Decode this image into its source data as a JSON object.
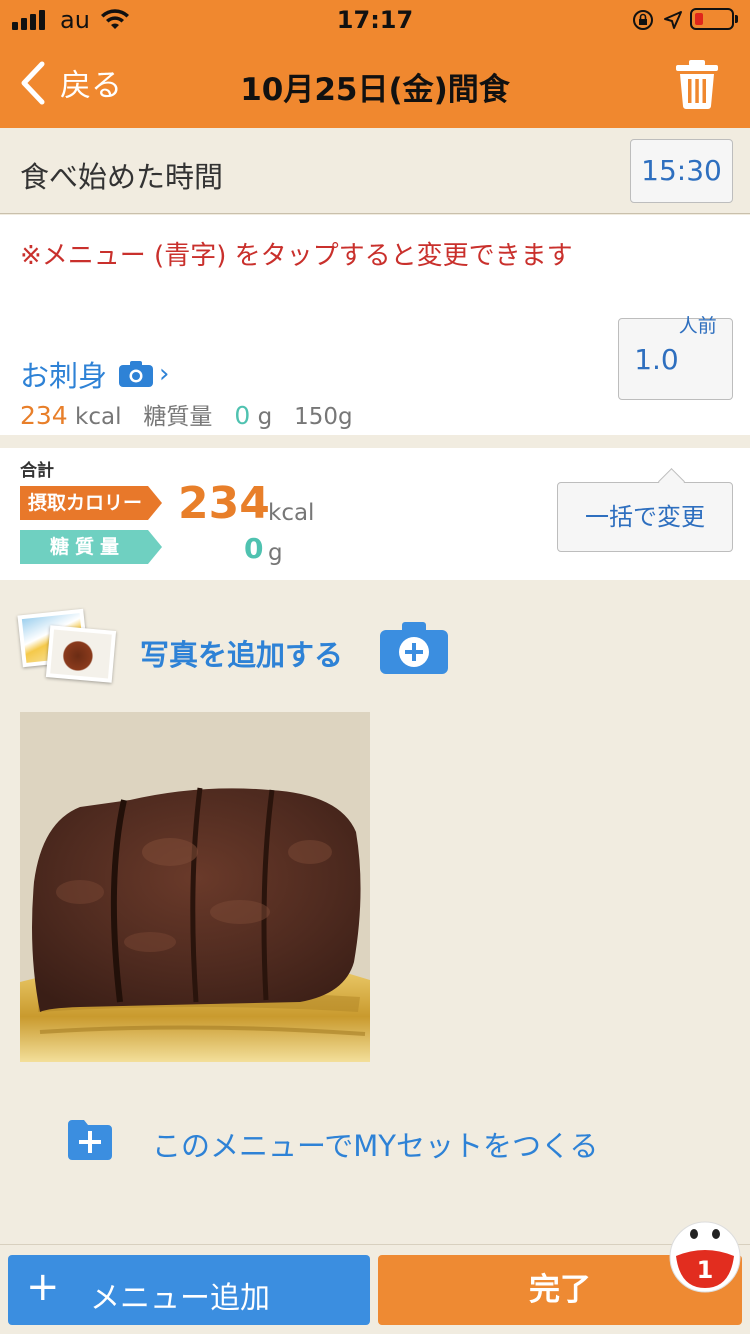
{
  "status": {
    "carrier": "au",
    "time": "17:17"
  },
  "nav": {
    "back_label": "戻る",
    "title": "10月25日(金)間食"
  },
  "start_time": {
    "label": "食べ始めた時間",
    "value": "15:30"
  },
  "menu": {
    "notice": "※メニュー (青字) をタップすると変更できます",
    "items": [
      {
        "name": "お刺身",
        "kcal": "234",
        "kcal_unit": "kcal",
        "carb_label": "糖質量",
        "carb_value": "0",
        "carb_unit": "g",
        "weight": "150g",
        "portion_value": "1.0",
        "portion_unit": "人前"
      }
    ]
  },
  "totals": {
    "header": "合計",
    "calorie_tag": "摂取カロリー",
    "carb_tag": "糖質量",
    "kcal_value": "234",
    "kcal_unit": "kcal",
    "carb_value": "0",
    "carb_unit": "g",
    "bulk_change_label": "一括で変更"
  },
  "photo": {
    "add_label": "写真を追加する"
  },
  "myset": {
    "label": "このメニューでMYセットをつくる"
  },
  "bottom": {
    "add_menu_plus": "+",
    "add_menu_label": "メニュー追加",
    "done_label": "完了",
    "badge_count": "1"
  },
  "colors": {
    "brand_orange": "#f0882f",
    "link_blue": "#2e82d6",
    "kcal_orange": "#e87f2a",
    "carb_teal": "#4fc2b0",
    "notice_red": "#c9302c"
  }
}
